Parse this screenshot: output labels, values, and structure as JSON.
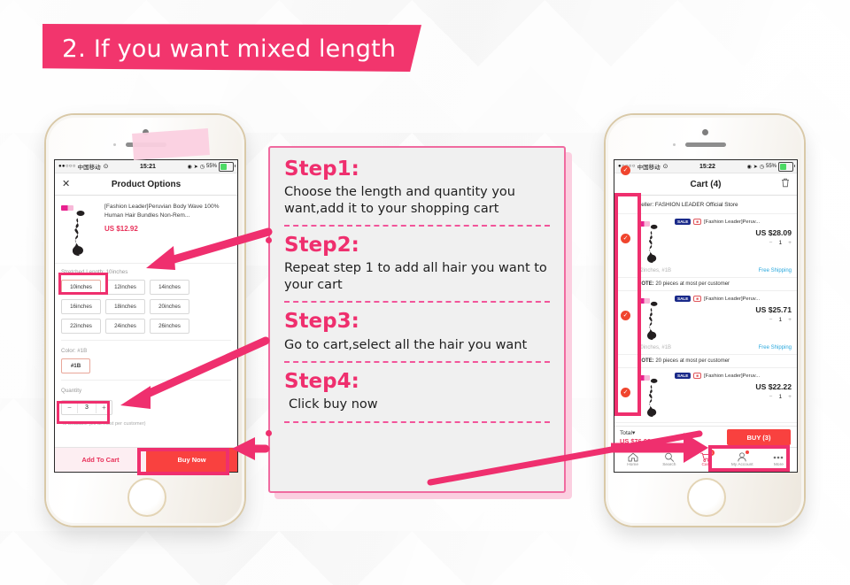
{
  "banner": {
    "number": "2.",
    "text": "If you want mixed length"
  },
  "steps": [
    {
      "heading": "Step1:",
      "body": "Choose the length and quantity you want,add it to your shopping cart"
    },
    {
      "heading": "Step2:",
      "body": "Repeat step 1 to add all hair you want to your cart"
    },
    {
      "heading": "Step3:",
      "body": "Go to cart,select all the hair you want"
    },
    {
      "heading": "Step4:",
      "body": "Click buy now"
    }
  ],
  "phone_left": {
    "status": {
      "dots": "●●○○○",
      "carrier": "中国移动",
      "wifi": "⊙",
      "time": "15:21",
      "battery_pct": "55%"
    },
    "nav": {
      "close": "✕",
      "title": "Product Options"
    },
    "product": {
      "title": "[Fashion Leader]Peruvian Body Wave 100% Human Hair Bundles Non-Rem...",
      "price": "US $12.92"
    },
    "length": {
      "label": "Stretched Length: 10inches",
      "options": [
        "10inches",
        "12inches",
        "14inches",
        "16inches",
        "18inches",
        "20inches",
        "22inches",
        "24inches",
        "26inches"
      ],
      "selected": "10inches"
    },
    "color": {
      "label": "Color: #1B",
      "options": [
        "#1B"
      ],
      "selected": "#1B"
    },
    "quantity": {
      "label": "Quantity",
      "minus": "−",
      "value": "3",
      "plus": "+",
      "note": "40 available (20  at most per customer)"
    },
    "cta": {
      "add_to_cart": "Add To Cart",
      "buy_now": "Buy Now"
    }
  },
  "phone_right": {
    "status": {
      "dots": "●○○○○",
      "carrier": "中国移动",
      "wifi": "⊙",
      "time": "15:22",
      "battery_pct": "55%"
    },
    "nav": {
      "title": "Cart (4)",
      "trash": "🗑"
    },
    "seller": "Seller: FASHION LEADER Official Store",
    "note": "NOTE: 20 pieces at most per customer",
    "note_prefix": "NOTE:",
    "note_body": " 20 pieces at most per customer",
    "items": [
      {
        "badge_sale": "SALE",
        "badge_flag": "■",
        "title": "[Fashion Leader]Peruv...",
        "price": "US $28.09",
        "qty": "1",
        "minus": "−",
        "plus": "+",
        "spec": "22inches, #1B",
        "shipping": "Free Shipping",
        "checked": true
      },
      {
        "badge_sale": "SALE",
        "badge_flag": "■",
        "title": "[Fashion Leader]Peruv...",
        "price": "US $25.71",
        "qty": "1",
        "minus": "−",
        "plus": "+",
        "spec": "20inches, #1B",
        "shipping": "Free Shipping",
        "checked": true
      },
      {
        "badge_sale": "SALE",
        "badge_flag": "■",
        "title": "[Fashion Leader]Peruv...",
        "price": "US $22.22",
        "qty": "1",
        "minus": "−",
        "plus": "+",
        "spec": "",
        "shipping": "",
        "checked": true
      }
    ],
    "total": {
      "label": "Total",
      "caret": "▾",
      "value": "US $76.02"
    },
    "buy_button": "BUY (3)",
    "tabs": [
      {
        "label": "Home",
        "icon": "home-icon"
      },
      {
        "label": "Search",
        "icon": "search-icon"
      },
      {
        "label": "Cart",
        "icon": "cart-icon",
        "badge": "4"
      },
      {
        "label": "My Account",
        "icon": "person-icon"
      },
      {
        "label": "More",
        "icon": "more-icon"
      }
    ]
  },
  "colors": {
    "accent_pink": "#ef2f6e",
    "banner_pink": "#f2356d",
    "buy_red": "#f9413f",
    "check_orange": "#f0452e",
    "link_blue": "#2aa8dd"
  }
}
